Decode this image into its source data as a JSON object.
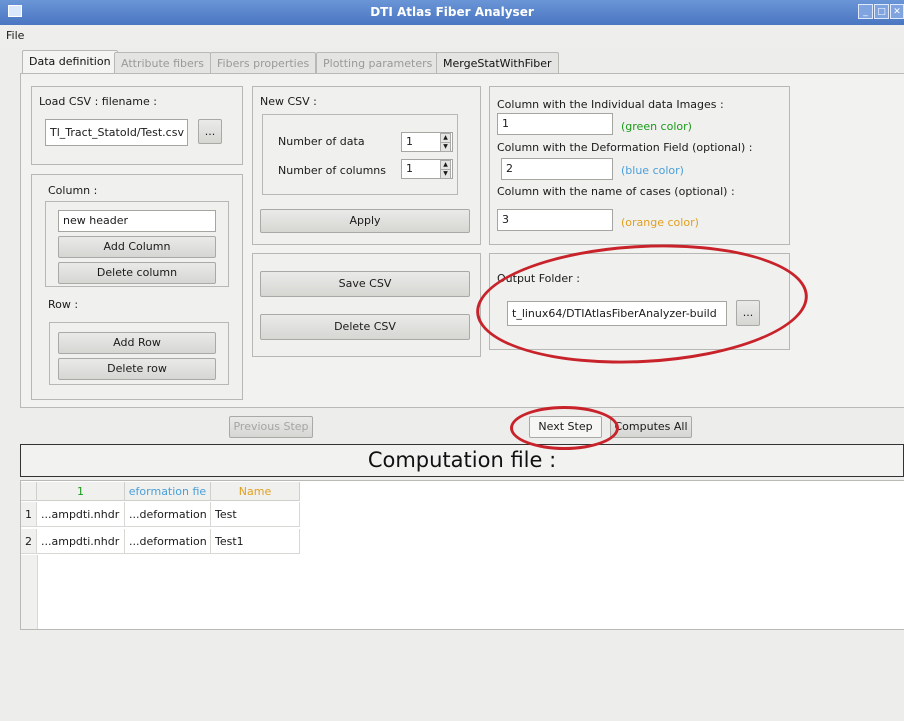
{
  "window": {
    "title": "DTI Atlas Fiber Analyser"
  },
  "menu": {
    "file": "File"
  },
  "tabs": [
    {
      "label": "Data definition"
    },
    {
      "label": "Attribute fibers"
    },
    {
      "label": "Fibers properties"
    },
    {
      "label": "Plotting parameters"
    },
    {
      "label": "MergeStatWithFiber"
    }
  ],
  "load_csv": {
    "label": "Load CSV : filename :",
    "value": "Tl_Tract_StatoId/Test.csv",
    "browse": "..."
  },
  "new_csv": {
    "label": "New CSV :",
    "num_data_label": "Number of data",
    "num_data_value": "1",
    "num_columns_label": "Number of columns",
    "num_columns_value": "1",
    "apply": "Apply"
  },
  "column": {
    "label": "Column :",
    "header_value": "new header",
    "add": "Add Column",
    "delete": "Delete column"
  },
  "row": {
    "label": "Row :",
    "add": "Add Row",
    "delete": "Delete row"
  },
  "csv_actions": {
    "save": "Save CSV",
    "delete": "Delete CSV"
  },
  "columns_info": {
    "individual_label": "Column with the Individual data Images :",
    "individual_value": "1",
    "individual_hint": "(green color)",
    "deformation_label": "Column with the Deformation Field (optional) :",
    "deformation_value": "2",
    "deformation_hint": "(blue color)",
    "cases_label": "Column with the name of cases (optional) :",
    "cases_value": "3",
    "cases_hint": "(orange color)"
  },
  "output": {
    "label": "Output Folder :",
    "value": "t_linux64/DTIAtlasFiberAnalyzer-build",
    "browse": "..."
  },
  "steps": {
    "previous": "Previous Step",
    "next": "Next Step",
    "compute_all": "Computes All"
  },
  "computation": {
    "title": "Computation file :",
    "headers": [
      "1",
      "eformation fie",
      "Name"
    ],
    "rows": [
      {
        "num": "1",
        "c1": "...ampdti.nhdr",
        "c2": "...deformation",
        "c3": "Test"
      },
      {
        "num": "2",
        "c1": "...ampdti.nhdr",
        "c2": "...deformation",
        "c3": "Test1"
      }
    ]
  },
  "colors": {
    "green": "#1a9a1a",
    "blue": "#4a9fd8",
    "orange": "#e0a020",
    "annotation": "#c8232a"
  }
}
